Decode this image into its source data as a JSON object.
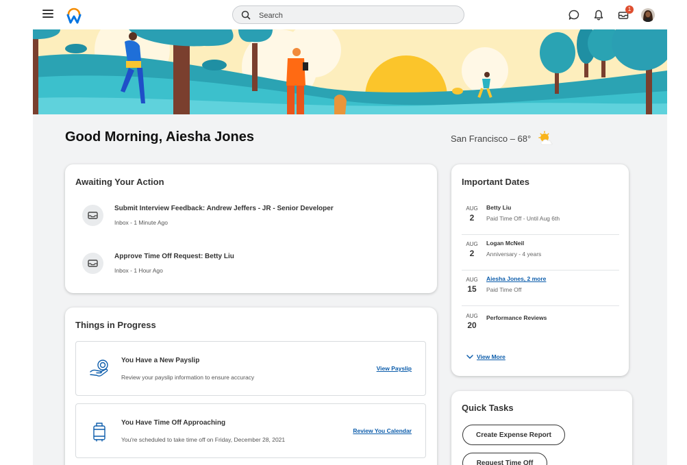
{
  "header": {
    "search_placeholder": "Search",
    "notification_count": "1"
  },
  "greeting": "Good Morning, Aiesha Jones",
  "weather": {
    "text": "San Francisco – 68°",
    "icon": "partly-sunny-icon"
  },
  "awaiting": {
    "title": "Awaiting Your Action",
    "items": [
      {
        "title": "Submit Interview Feedback: Andrew Jeffers - JR - Senior Developer",
        "sub": "Inbox - 1 Minute Ago"
      },
      {
        "title": "Approve Time Off Request: Betty Liu",
        "sub": "Inbox - 1 Hour Ago"
      }
    ]
  },
  "progress": {
    "title": "Things in Progress",
    "items": [
      {
        "title": "You Have a New Payslip",
        "sub": "Review your payslip information to ensure accuracy",
        "link": "View Payslip",
        "icon": "payslip-icon"
      },
      {
        "title": "You Have Time Off Approaching",
        "sub": "You're scheduled to take time off on Friday, December 28, 2021",
        "link": "Review You Calendar",
        "icon": "luggage-icon"
      }
    ]
  },
  "dates": {
    "title": "Important Dates",
    "items": [
      {
        "month": "AUG",
        "day": "2",
        "name": "Betty Liu",
        "desc": "Paid Time Off - Until Aug 6th"
      },
      {
        "month": "AUG",
        "day": "2",
        "name": "Logan McNeil",
        "desc": "Anniversary - 4 years"
      },
      {
        "month": "AUG",
        "day": "15",
        "name": "Aiesha Jones, 2 more",
        "desc": "Paid Time Off"
      },
      {
        "month": "AUG",
        "day": "20",
        "name": "Performance Reviews",
        "desc": ""
      }
    ],
    "view_more": "View More"
  },
  "quick_tasks": {
    "title": "Quick Tasks",
    "buttons": [
      "Create Expense Report",
      "Request Time Off"
    ]
  },
  "colors": {
    "accent_link": "#0b5cab",
    "badge": "#de4e2f",
    "background": "#f2f3f4"
  }
}
